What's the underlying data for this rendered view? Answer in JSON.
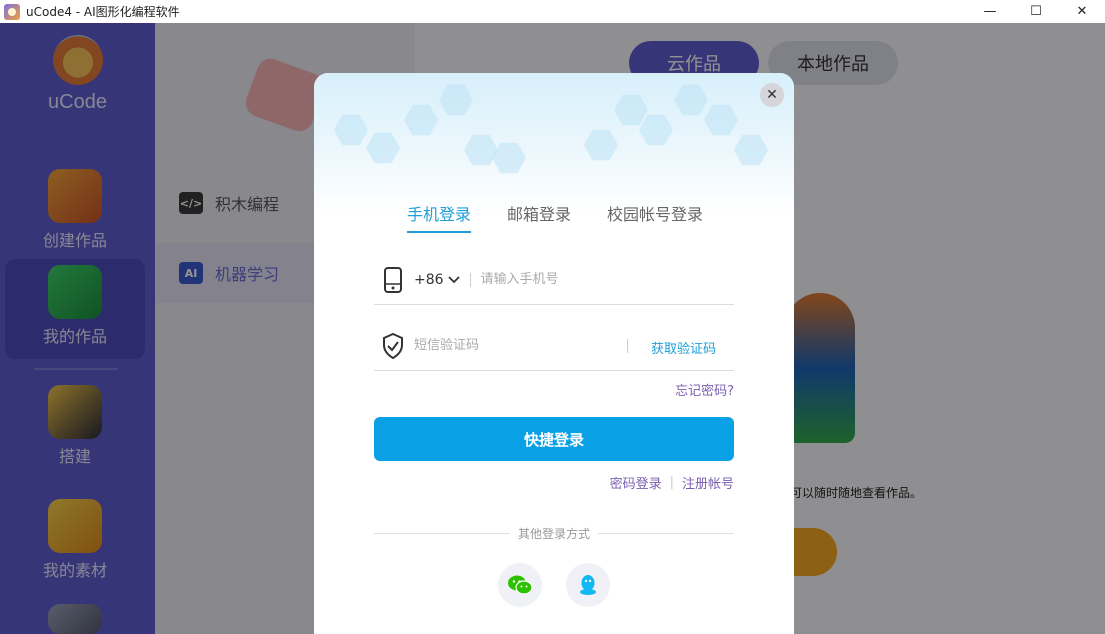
{
  "window": {
    "title": "uCode4 - AI图形化编程软件",
    "controls": {
      "minimize": "—",
      "maximize": "☐",
      "close": "✕"
    }
  },
  "sidebar": {
    "brand": "uCode",
    "items": [
      {
        "label": "创建作品",
        "icon": "start-icon"
      },
      {
        "label": "我的作品",
        "icon": "folder-icon",
        "active": true
      },
      {
        "label": "搭建",
        "icon": "robot-icon"
      },
      {
        "label": "我的素材",
        "icon": "materials-icon"
      }
    ]
  },
  "menu": {
    "items": [
      {
        "label": "积木编程",
        "icon": "code-icon",
        "icon_text": "</>"
      },
      {
        "label": "机器学习",
        "icon": "ai-icon",
        "icon_text": "AI",
        "active": true
      }
    ]
  },
  "main": {
    "tabs": [
      {
        "label": "云作品",
        "active": true
      },
      {
        "label": "本地作品",
        "active": false
      }
    ],
    "hint": "可以随时随地查看作品。"
  },
  "login": {
    "tabs": [
      {
        "label": "手机登录",
        "active": true
      },
      {
        "label": "邮箱登录",
        "active": false
      },
      {
        "label": "校园帐号登录",
        "active": false
      }
    ],
    "country_code": "+86",
    "phone_placeholder": "请输入手机号",
    "code_placeholder": "短信验证码",
    "get_code": "获取验证码",
    "forgot": "忘记密码?",
    "submit": "快捷登录",
    "password_login": "密码登录",
    "link_sep": "|",
    "register": "注册帐号",
    "other_methods": "其他登录方式",
    "close": "✕"
  },
  "colors": {
    "sidebar": "#5d5ccf",
    "accent": "#1d9fd8",
    "primary_button": "#0aa0e6",
    "link": "#7a5fb0"
  }
}
